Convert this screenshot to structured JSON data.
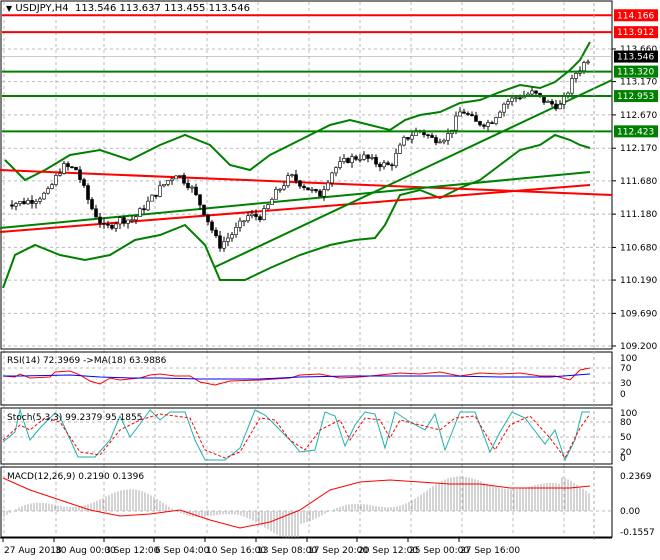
{
  "header": {
    "symbol": "USDJPY,H4",
    "ohlc": "113.546 113.637 113.455 113.546",
    "menu_icon": "triangle-down-icon"
  },
  "price_axis": [
    "113.660",
    "113.170",
    "112.670",
    "112.170",
    "111.680",
    "111.180",
    "110.680",
    "110.190",
    "109.690",
    "109.200"
  ],
  "levels": [
    {
      "label": "114.166",
      "value": 114.166,
      "color": "#ff0000"
    },
    {
      "label": "113.912",
      "value": 113.912,
      "color": "#ff0000"
    },
    {
      "label": "113.546",
      "value": 113.546,
      "color": "#000000"
    },
    {
      "label": "113.320",
      "value": 113.32,
      "color": "#008000"
    },
    {
      "label": "112.953",
      "value": 112.953,
      "color": "#008000"
    },
    {
      "label": "112.423",
      "value": 112.423,
      "color": "#008000"
    }
  ],
  "rsi": {
    "title": "RSI(14) 72.3969  ->MA(18) 63.9886",
    "axis": [
      "100",
      "70",
      "30",
      "0"
    ]
  },
  "stoch": {
    "title": "Stoch(5,3,3) 99.2379 95.1855",
    "axis": [
      "100",
      "80",
      "50",
      "20",
      "0"
    ]
  },
  "macd": {
    "title": "MACD(12,26,9) 0.2190 0.1396",
    "axis": [
      "0.2369",
      "0.00",
      "-0.1557"
    ]
  },
  "time_axis": [
    "27 Aug 2018",
    "30 Aug 00:00",
    "3 Sep 12:00",
    "6 Sep 04:00",
    "10 Sep 16:00",
    "13 Sep 08:00",
    "17 Sep 20:00",
    "20 Sep 12:00",
    "25 Sep 00:00",
    "27 Sep 16:00"
  ],
  "chart_data": {
    "type": "candlestick",
    "closes": [
      111.35,
      111.35,
      111.4,
      111.5,
      111.9,
      111.85,
      111.3,
      110.95,
      111.1,
      111.1,
      111.35,
      111.6,
      111.8,
      111.6,
      111.2,
      110.7,
      110.9,
      111.15,
      111.15,
      111.5,
      111.75,
      111.6,
      111.45,
      111.85,
      112.0,
      112.05,
      111.95,
      111.9,
      112.3,
      112.45,
      112.3,
      112.35,
      112.75,
      112.55,
      112.55,
      112.85,
      112.95,
      113.0,
      112.85,
      112.8,
      113.3,
      113.55
    ],
    "ylim": [
      109.2,
      114.3
    ],
    "colors": {
      "up": "#008000",
      "down": "#000000",
      "bands": "#008000",
      "support": "#ff0000"
    }
  }
}
